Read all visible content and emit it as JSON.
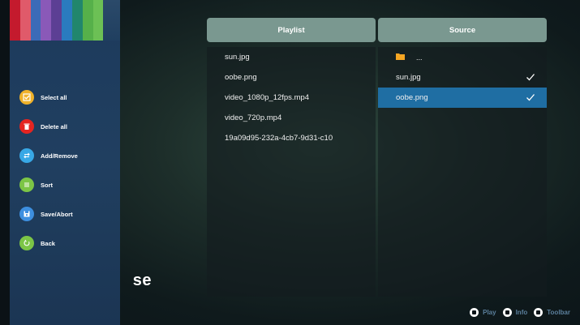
{
  "sidebar": {
    "stripe_colors": [
      "#c41a2d",
      "#e05a6a",
      "#3b6bb8",
      "#8a59b8",
      "#5c3f94",
      "#2a7bbf",
      "#21866d",
      "#56b04a",
      "#6cc055"
    ],
    "items": [
      {
        "label": "Select all",
        "icon": "select-all-icon",
        "color": "#f0b22a"
      },
      {
        "label": "Delete all",
        "icon": "trash-icon",
        "color": "#e52521"
      },
      {
        "label": "Add/Remove",
        "icon": "swap-icon",
        "color": "#38a8e6"
      },
      {
        "label": "Sort",
        "icon": "list-icon",
        "color": "#7cc546"
      },
      {
        "label": "Save/Abort",
        "icon": "save-icon",
        "color": "#3d8fe0"
      },
      {
        "label": "Back",
        "icon": "back-icon",
        "color": "#7cc546"
      }
    ]
  },
  "background_title": "se",
  "playlist": {
    "header": "Playlist",
    "items": [
      "sun.jpg",
      "oobe.png",
      "video_1080p_12fps.mp4",
      "video_720p.mp4",
      "19a09d95-232a-4cb7-9d31-c10"
    ]
  },
  "source": {
    "header": "Source",
    "parent_dots": "...",
    "items": [
      {
        "name": "sun.jpg",
        "checked": true,
        "selected": false
      },
      {
        "name": "oobe.png",
        "checked": true,
        "selected": true
      }
    ]
  },
  "bottom_bar": {
    "play": "Play",
    "info": "Info",
    "toolbar": "Toolbar"
  },
  "colors": {
    "header_bg": "#7a9890",
    "selected_row": "#1f6ea3",
    "bottom_text": "#5b7f9c",
    "folder": "#f5a623"
  }
}
